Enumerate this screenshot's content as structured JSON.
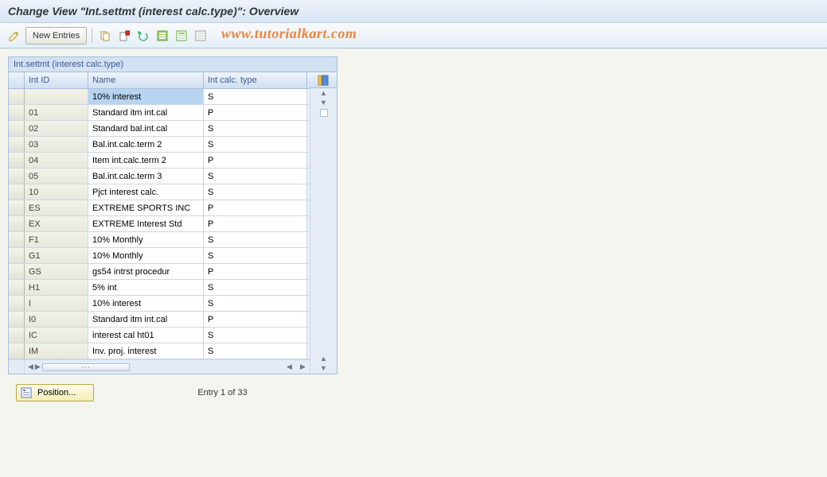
{
  "title": "Change View \"Int.settmt (interest calc.type)\": Overview",
  "toolbar": {
    "new_entries_label": "New Entries"
  },
  "watermark": "www.tutorialkart.com",
  "panel": {
    "title": "Int.settmt (interest calc.type)"
  },
  "columns": {
    "int_id": "Int ID",
    "name": "Name",
    "type": "Int calc. type"
  },
  "rows": [
    {
      "id": "",
      "name": "10% interest",
      "type": "S",
      "selected": true
    },
    {
      "id": "01",
      "name": "Standard itm int.cal",
      "type": "P"
    },
    {
      "id": "02",
      "name": "Standard bal.int.cal",
      "type": "S"
    },
    {
      "id": "03",
      "name": "Bal.int.calc.term 2",
      "type": "S"
    },
    {
      "id": "04",
      "name": "Item int.calc.term 2",
      "type": "P"
    },
    {
      "id": "05",
      "name": "Bal.int.calc.term 3",
      "type": "S"
    },
    {
      "id": "10",
      "name": "Pjct interest calc.",
      "type": "S"
    },
    {
      "id": "ES",
      "name": "EXTREME SPORTS INC",
      "type": "P"
    },
    {
      "id": "EX",
      "name": "EXTREME Interest Std",
      "type": "P"
    },
    {
      "id": "F1",
      "name": "10% Monthly",
      "type": "S"
    },
    {
      "id": "G1",
      "name": "10% Monthly",
      "type": "S"
    },
    {
      "id": "GS",
      "name": "gs54 intrst procedur",
      "type": "P"
    },
    {
      "id": "H1",
      "name": "5% int",
      "type": "S"
    },
    {
      "id": "I",
      "name": "10% interest",
      "type": "S"
    },
    {
      "id": "I0",
      "name": "Standard itm int.cal",
      "type": "P"
    },
    {
      "id": "IC",
      "name": "interest cal ht01",
      "type": "S"
    },
    {
      "id": "IM",
      "name": "Inv. proj. interest",
      "type": "S"
    }
  ],
  "footer": {
    "position_label": "Position...",
    "entry_text": "Entry 1 of 33"
  }
}
